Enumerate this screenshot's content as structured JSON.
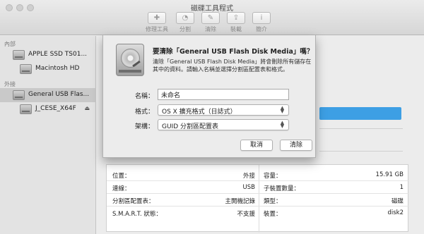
{
  "window": {
    "title": "磁碟工具程式"
  },
  "toolbar": {
    "items": [
      {
        "label": "修理工具",
        "icon": "stethoscope-icon",
        "glyph": "✚"
      },
      {
        "label": "分割",
        "icon": "partition-icon",
        "glyph": "◔"
      },
      {
        "label": "清除",
        "icon": "erase-icon",
        "glyph": "✎"
      },
      {
        "label": "裝載",
        "icon": "mount-icon",
        "glyph": "⇪"
      },
      {
        "label": "簡介",
        "icon": "info-icon",
        "glyph": "i"
      }
    ]
  },
  "sidebar": {
    "internal_header": "內部",
    "external_header": "外接",
    "items": [
      {
        "label": "APPLE SSD TS01...",
        "icon": "internal-disk-icon"
      },
      {
        "label": "Macintosh HD",
        "icon": "volume-icon"
      },
      {
        "label": "General USB Flas...",
        "icon": "usb-disk-icon"
      },
      {
        "label": "J_CESE_X64F",
        "icon": "volume-icon"
      }
    ],
    "eject_glyph": "⏏"
  },
  "sheet": {
    "title": "要清除「General USB Flash Disk Media」嗎？",
    "description": "清除「General USB Flash Disk Media」將會刪除所有儲存在其中的資料。請輸入名稱並選擇分割區配置表和格式。",
    "name_label": "名稱：",
    "name_value": "未命名",
    "format_label": "格式：",
    "format_value": "OS X 擴充格式（日誌式）",
    "scheme_label": "架構：",
    "scheme_value": "GUID 分割區配置表",
    "cancel_label": "取消",
    "erase_label": "清除"
  },
  "info": {
    "left": [
      {
        "label": "位置：",
        "value": "外接"
      },
      {
        "label": "連線：",
        "value": "USB"
      },
      {
        "label": "分割區配置表：",
        "value": "主開機記錄"
      },
      {
        "label": "S.M.A.R.T. 狀態：",
        "value": "不支援"
      }
    ],
    "right": [
      {
        "label": "容量：",
        "value": "15.91 GB"
      },
      {
        "label": "子裝置數量：",
        "value": "1"
      },
      {
        "label": "類型：",
        "value": "磁碟"
      },
      {
        "label": "裝置：",
        "value": "disk2"
      }
    ]
  },
  "colors": {
    "accent": "#3d9fe4",
    "selection": "#c9c9c9"
  }
}
